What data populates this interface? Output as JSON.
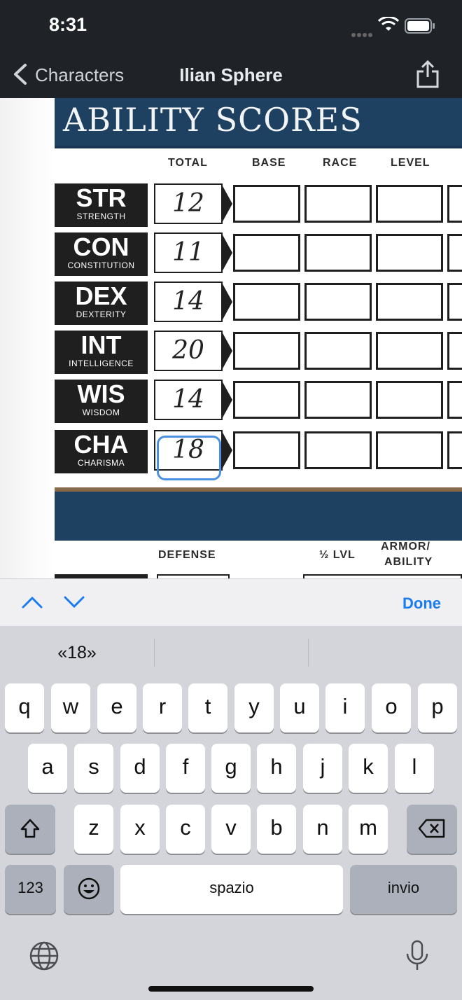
{
  "status": {
    "time": "8:31"
  },
  "nav": {
    "back_label": "Characters",
    "title": "Ilian Sphere"
  },
  "sheet": {
    "title": "ABILITY SCORES",
    "columns": [
      "TOTAL",
      "BASE",
      "RACE",
      "LEVEL"
    ],
    "rows": [
      {
        "abbr": "STR",
        "name": "STRENGTH",
        "total": "12"
      },
      {
        "abbr": "CON",
        "name": "CONSTITUTION",
        "total": "11"
      },
      {
        "abbr": "DEX",
        "name": "DEXTERITY",
        "total": "14"
      },
      {
        "abbr": "INT",
        "name": "INTELLIGENCE",
        "total": "20"
      },
      {
        "abbr": "WIS",
        "name": "WISDOM",
        "total": "14"
      },
      {
        "abbr": "CHA",
        "name": "CHARISMA",
        "total": "18"
      }
    ],
    "defense_headers": {
      "defense": "DEFENSE",
      "half_lvl": "½ LVL",
      "armor": "ARMOR/",
      "ability": "ABILITY"
    }
  },
  "accessory": {
    "done_label": "Done"
  },
  "keyboard": {
    "suggestions": [
      "«18»",
      "",
      ""
    ],
    "row1": [
      "q",
      "w",
      "e",
      "r",
      "t",
      "y",
      "u",
      "i",
      "o",
      "p"
    ],
    "row2": [
      "a",
      "s",
      "d",
      "f",
      "g",
      "h",
      "j",
      "k",
      "l"
    ],
    "row3": [
      "z",
      "x",
      "c",
      "v",
      "b",
      "n",
      "m"
    ],
    "numbers_label": "123",
    "space_label": "spazio",
    "return_label": "invio"
  },
  "colors": {
    "banner": "#1e4162",
    "accent": "#1a7cf0",
    "focus": "#4a90e2"
  },
  "icons": [
    "back-chevron-icon",
    "share-icon",
    "wifi-icon",
    "battery-icon",
    "chevron-up-icon",
    "chevron-down-icon",
    "shift-icon",
    "backspace-icon",
    "emoji-icon",
    "globe-icon",
    "microphone-icon"
  ]
}
